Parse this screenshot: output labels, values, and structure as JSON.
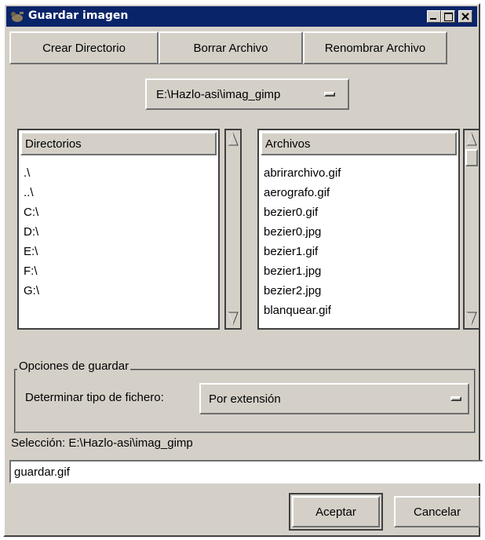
{
  "window": {
    "title": "Guardar imagen"
  },
  "toolbar": {
    "create_dir": "Crear Directorio",
    "delete_file": "Borrar Archivo",
    "rename_file": "Renombrar Archivo"
  },
  "path_selector": {
    "value": "E:\\Hazlo-asi\\imag_gimp"
  },
  "directories": {
    "header": "Directorios",
    "items": [
      ".\\",
      "..\\",
      "C:\\",
      "D:\\",
      "E:\\",
      "F:\\",
      "G:\\"
    ]
  },
  "files": {
    "header": "Archivos",
    "items": [
      "abrirarchivo.gif",
      "aerografo.gif",
      "bezier0.gif",
      "bezier0.jpg",
      "bezier1.gif",
      "bezier1.jpg",
      "bezier2.jpg",
      "blanquear.gif"
    ]
  },
  "options": {
    "group_label": "Opciones de guardar",
    "file_type_label": "Determinar tipo de fichero:",
    "file_type_value": "Por extensión"
  },
  "selection": {
    "label": "Selección: E:\\Hazlo-asi\\imag_gimp",
    "filename": "guardar.gif"
  },
  "buttons": {
    "ok": "Aceptar",
    "cancel": "Cancelar"
  },
  "colors": {
    "titlebar": "#0a246a",
    "face": "#d4d0c8"
  }
}
